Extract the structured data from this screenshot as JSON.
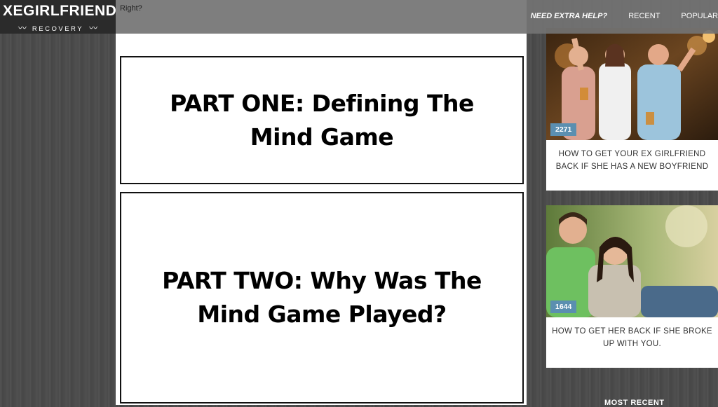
{
  "header": {
    "logo_main": "XEGIRLFRIEND",
    "logo_sub": "RECOVERY",
    "tagline": "Right?",
    "nav": [
      {
        "label": "NEED EXTRA HELP?"
      },
      {
        "label": "RECENT"
      },
      {
        "label": "POPULAR"
      }
    ]
  },
  "main": {
    "parts": [
      {
        "title": "PART ONE: Defining The Mind Game"
      },
      {
        "title": "PART TWO: Why Was The Mind Game Played?"
      }
    ]
  },
  "sidebar": {
    "posts": [
      {
        "count": "2271",
        "title": "HOW TO GET YOUR EX GIRLFRIEND BACK IF SHE HAS A NEW BOYFRIEND",
        "image": "friends-cheering-photo"
      },
      {
        "count": "1644",
        "title": "HOW TO GET HER BACK IF SHE BROKE UP WITH YOU.",
        "image": "couple-in-park-photo"
      }
    ],
    "section_label": "MOST RECENT"
  },
  "colors": {
    "count_badge": "#5b8fb0",
    "topbar": "#737373"
  }
}
